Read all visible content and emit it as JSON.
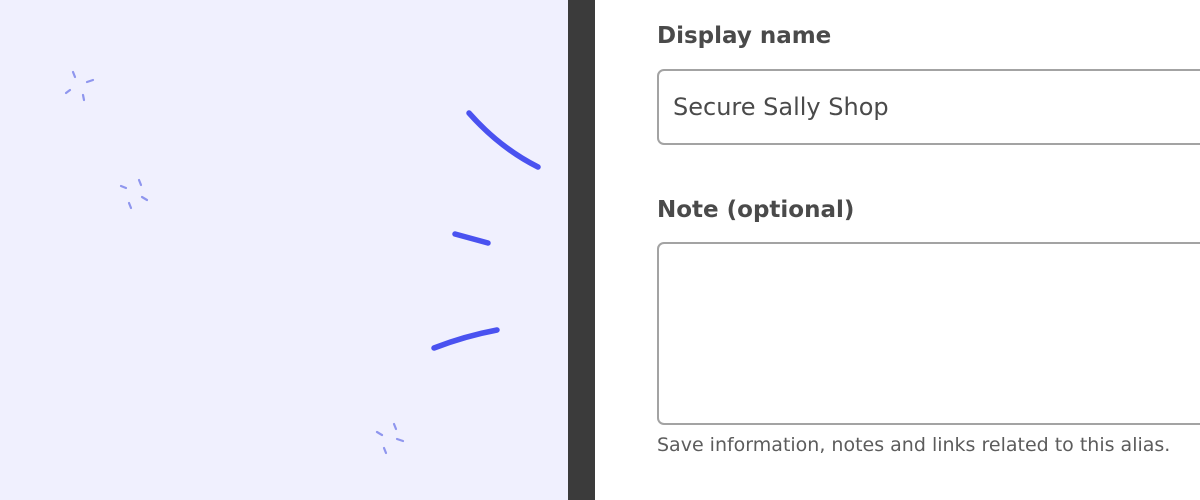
{
  "illustration": {
    "accent_color": "#4a52f0",
    "sparkle_color": "#8f96ee",
    "background_color": "#f0f0fe"
  },
  "form": {
    "display_name": {
      "label": "Display name",
      "value": "Secure Sally Shop"
    },
    "note": {
      "label": "Note (optional)",
      "value": "",
      "hint": "Save information, notes and links related to this alias."
    }
  }
}
